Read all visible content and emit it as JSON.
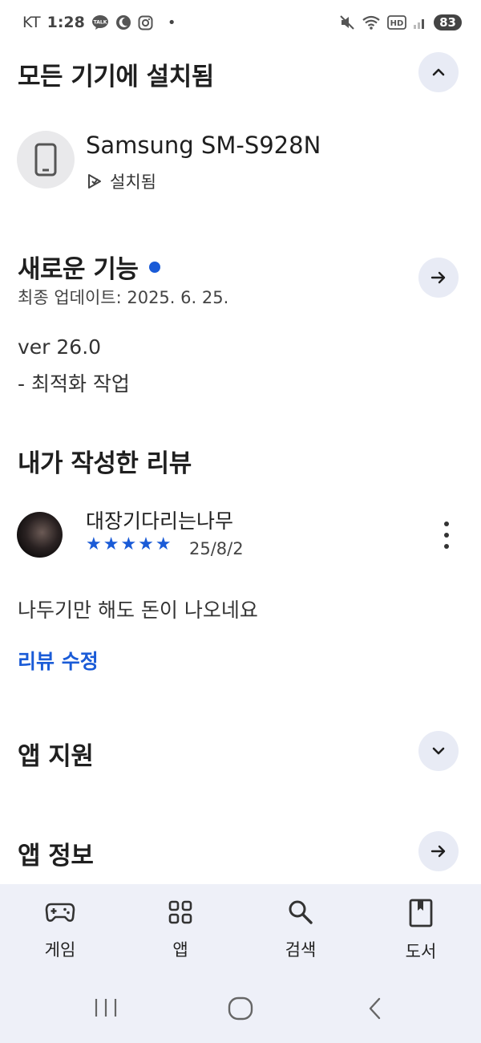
{
  "status_bar": {
    "carrier": "KT",
    "time": "1:28",
    "dot": "•",
    "talk_badge": "TALK",
    "hd_badge": "HD",
    "battery": "83"
  },
  "installed_section": {
    "title": "모든 기기에 설치됨",
    "device_name": "Samsung SM-S928N",
    "device_status": "설치됨"
  },
  "whats_new": {
    "title": "새로운 기능",
    "updated": "최종 업데이트: 2025. 6. 25.",
    "version": "ver 26.0",
    "note": "- 최적화 작업"
  },
  "my_review": {
    "title": "내가 작성한 리뷰",
    "reviewer": "대장기다리는나무",
    "rating": 5,
    "stars": "★★★★★",
    "date": "25/8/2",
    "text": "나두기만 해도 돈이 나오네요",
    "edit_link": "리뷰 수정"
  },
  "app_support": {
    "title": "앱 지원"
  },
  "app_info": {
    "title": "앱 정보"
  },
  "bottom_nav": {
    "items": [
      {
        "label": "게임",
        "icon": "gamepad-icon"
      },
      {
        "label": "앱",
        "icon": "apps-grid-icon"
      },
      {
        "label": "검색",
        "icon": "search-icon"
      },
      {
        "label": "도서",
        "icon": "book-icon"
      }
    ]
  },
  "colors": {
    "accent": "#1a5bd7",
    "button_bg": "#e8ebf5",
    "nav_bg": "#eef0f8"
  }
}
